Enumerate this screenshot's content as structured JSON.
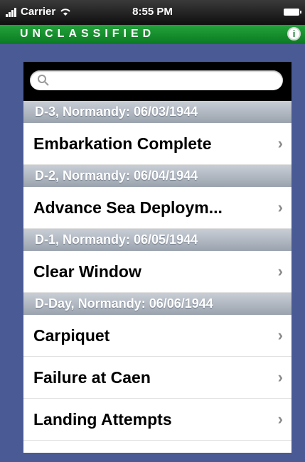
{
  "status_bar": {
    "carrier": "Carrier",
    "time": "8:55 PM"
  },
  "class_bar": {
    "label": "UNCLASSIFIED",
    "info_icon": "info-icon"
  },
  "search": {
    "placeholder": "",
    "value": ""
  },
  "sections": [
    {
      "header": "D-3, Normandy: 06/03/1944",
      "rows": [
        {
          "label": "Embarkation Complete"
        }
      ]
    },
    {
      "header": "D-2, Normandy: 06/04/1944",
      "rows": [
        {
          "label": "Advance Sea Deploym..."
        }
      ]
    },
    {
      "header": "D-1, Normandy: 06/05/1944",
      "rows": [
        {
          "label": "Clear Window"
        }
      ]
    },
    {
      "header": "D-Day, Normandy: 06/06/1944",
      "rows": [
        {
          "label": "Carpiquet"
        },
        {
          "label": "Failure at Caen"
        },
        {
          "label": "Landing Attempts"
        }
      ]
    }
  ],
  "colors": {
    "classification_bar": "#0b7a23",
    "background": "#4a5a95",
    "section_header": "#9aa3ae"
  }
}
